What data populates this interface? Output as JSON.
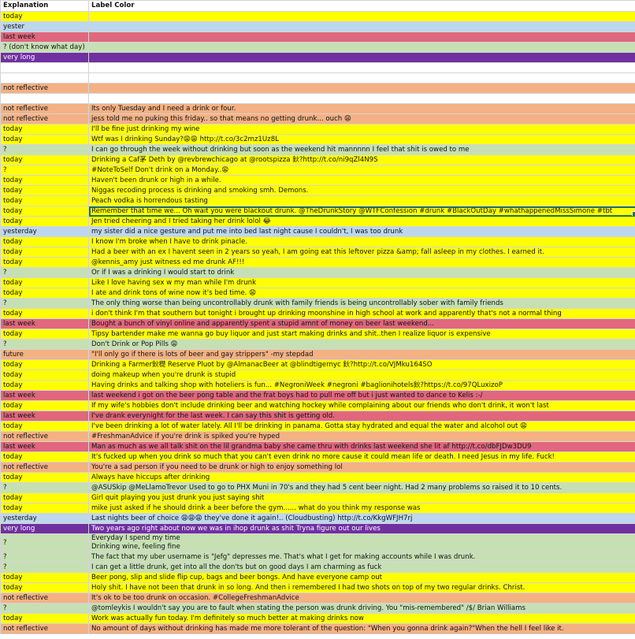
{
  "header": {
    "explanation": "Explanation",
    "label_color": "Label Color"
  },
  "colors": {
    "today": "#ffff00",
    "yesterday": "#bdd7ee",
    "last_week": "#e0677d",
    "unknown": "#c6e0b4",
    "very_long": "#7030a0",
    "not_reflective": "#f4b183",
    "selection": "#217346"
  },
  "rows": [
    {
      "explanation": "today",
      "text": "",
      "color": "yellow"
    },
    {
      "explanation": "yester",
      "text": "",
      "color": "blue"
    },
    {
      "explanation": "last week",
      "text": "",
      "color": "red"
    },
    {
      "explanation": "? (don't know what day)",
      "text": "",
      "color": "green"
    },
    {
      "explanation": "very long",
      "text": "",
      "color": "purple"
    },
    {
      "explanation": "",
      "text": "",
      "color": "white"
    },
    {
      "explanation": "",
      "text": "",
      "color": "white"
    },
    {
      "explanation": "not reflective",
      "text": "",
      "color": "orange"
    },
    {
      "explanation": "",
      "text": "",
      "color": "white"
    },
    {
      "explanation": "not reflective",
      "text": "Its only Tuesday and I need a drink or four.",
      "color": "orange"
    },
    {
      "explanation": "not reflective",
      "text": "jess told me no puking this friday.. so that means no getting drunk... ouch 😩",
      "color": "orange"
    },
    {
      "explanation": "today",
      "text": "I'll be fine just drinking my wine",
      "color": "yellow"
    },
    {
      "explanation": "today",
      "text": "Wtf was I drinking Sunday?😩😩 http://t.co/3c2mz1Uz8L",
      "color": "yellow"
    },
    {
      "explanation": "?",
      "text": "I can go through the week without drinking but soon as the weekend hit mannnnn I feel that shit is owed to me",
      "color": "green"
    },
    {
      "explanation": "today",
      "text": "Drinking a Caf茅 Deth by @revbrewchicago at @rootspizza 鈥?http://t.co/ni9qZl4N9S",
      "color": "yellow"
    },
    {
      "explanation": "?",
      "text": "#NoteToSelf Don't drink on a Monday..😩",
      "color": "yellow"
    },
    {
      "explanation": "today",
      "text": "Haven't been drunk or high in a while.",
      "color": "yellow"
    },
    {
      "explanation": "today",
      "text": "Niggas recoding process is drinking and smoking smh. Demons.",
      "color": "yellow"
    },
    {
      "explanation": "today",
      "text": "Peach vodka is horrendous tasting",
      "color": "yellow"
    },
    {
      "explanation": "today",
      "text": "Remember that time we... Oh wait you were blackout drunk. @TheDrunkStory @WTFConfession #drunk #BlackOutDay #whathappenedMissSimone #tbt",
      "color": "yellow",
      "selected": true
    },
    {
      "explanation": "today",
      "text": "Jen tried cheering and I tried taking her drink lolol 😂",
      "color": "yellow"
    },
    {
      "explanation": "yesterday",
      "text": "my sister did a nice gesture and put me into bed last night cause I couldn't, I was too drunk",
      "color": "blue"
    },
    {
      "explanation": "today",
      "text": "I know I'm broke when I have to drink pinacle.",
      "color": "yellow"
    },
    {
      "explanation": "today",
      "text": "Had a beer with an ex I havent seen in 2 years so yeah, I am going eat this leftover pizza &amp; fall asleep in my clothes. I earned it.",
      "color": "yellow"
    },
    {
      "explanation": "today",
      "text": "@kennis_amy just witness ed me drunk AF!!!",
      "color": "yellow"
    },
    {
      "explanation": "?",
      "text": "Or if I was a drinking I would start to drink",
      "color": "green"
    },
    {
      "explanation": "today",
      "text": "Like I love having sex w my man while I'm drunk",
      "color": "yellow"
    },
    {
      "explanation": "today",
      "text": "I ate and drink tons of wine now it's bed time. 😩",
      "color": "yellow"
    },
    {
      "explanation": "?",
      "text": "The only thing worse than being uncontrollably drunk with family friends is being uncontrollably sober with family friends",
      "color": "green"
    },
    {
      "explanation": "today",
      "text": "i don't think I'm that southern but tonight i brought up drinking moonshine in high school at work and apparently that's not a normal thing",
      "color": "yellow"
    },
    {
      "explanation": "last week",
      "text": "Bought a bunch of vinyl online and apparently spent a stupid amnt of money on beer last weekend...",
      "color": "red"
    },
    {
      "explanation": "today",
      "text": "Tipsy bartender make me wanna go buy liquor and just start making drinks and shit..then I realize liquor is expensive",
      "color": "yellow"
    },
    {
      "explanation": "?",
      "text": "Don't Drink or Pop Pills 😩",
      "color": "green"
    },
    {
      "explanation": "future",
      "text": "\"I'll only go if there is lots of beer and gay strippers\" -my stepdad",
      "color": "orange"
    },
    {
      "explanation": "today",
      "text": "Drinking a Farmer鈥檚 Reserve Pluot by @AlmanacBeer at @blindtigernyc 鈥?http://t.co/VJMku164SO",
      "color": "yellow"
    },
    {
      "explanation": "today",
      "text": "doing makeup when you're drunk is stupid",
      "color": "yellow"
    },
    {
      "explanation": "today",
      "text": "Having drinks and talking shop with hoteliers is fun... #NegroniWeek #negroni #baglionihotels鈥?https://t.co/97QLuxizoP",
      "color": "yellow"
    },
    {
      "explanation": "last week",
      "text": "last weekend i got on the beer pong table and the frat boys had to pull me off but i just wanted to dance to Kelis :-/",
      "color": "red"
    },
    {
      "explanation": "today",
      "text": "If my wife's hobbies don't include drinking beer and watching hockey while complaining about our friends who don't drink, it won't last",
      "color": "yellow"
    },
    {
      "explanation": "last week",
      "text": "I've drank everynight for the last week. I can say this shit is getting old.",
      "color": "red"
    },
    {
      "explanation": "today",
      "text": "I've been drinking a lot of water lately. All I'll be drinking in panama. Gotta stay hydrated and equal the water and alcohol out 😩",
      "color": "yellow"
    },
    {
      "explanation": "not reflective",
      "text": "#FreshmanAdvice if you're drink is spiked you're hyped",
      "color": "orange"
    },
    {
      "explanation": "last week",
      "text": "Man as much as we all talk shit on the lil grandma baby she came thru with drinks last weekend she lit af http://t.co/dbFJDw3DU9",
      "color": "red"
    },
    {
      "explanation": "today",
      "text": "It's fucked up when you drink so much that you can't even drink no more cause it could mean life or death. I need Jesus in my life. Fuck!",
      "color": "yellow"
    },
    {
      "explanation": "not reflective",
      "text": "You're a sad person if you need to be drunk or high to enjoy something lol",
      "color": "orange"
    },
    {
      "explanation": "today",
      "text": "Always have hiccups after drinking",
      "color": "yellow"
    },
    {
      "explanation": "?",
      "text": "@ASUSkip @MeLlamoTrevor Used to go to PHX Muni in 70's and they had 5 cent beer night. Had 2 many problems so raised it to 10 cents.",
      "color": "green"
    },
    {
      "explanation": "today",
      "text": "Girl quit playing you just drunk you just saying shit",
      "color": "yellow"
    },
    {
      "explanation": "today",
      "text": "mike just asked if he should drink a beer before the gym...... what do you think my response was",
      "color": "yellow"
    },
    {
      "explanation": "yesterday",
      "text": "Last nights beer of choice 😩😩😩 they've done it again!.. (Cloudbusting) http://t.co/KkgWFJH7rj",
      "color": "blue"
    },
    {
      "explanation": "very long",
      "text": "Two years ago right about now we was in ihop drunk as shit Tryna figure out our lives",
      "color": "purple"
    },
    {
      "explanation": "?",
      "text": "Everyday I spend my time\nDrinking wine, feeling fine",
      "color": "green",
      "wrap": true
    },
    {
      "explanation": "?",
      "text": "The fact that my uber username is \"Jefg\" depresses me. That's what I get for making accounts while I was drunk.",
      "color": "green"
    },
    {
      "explanation": "?",
      "text": "I can get a little drunk, get into all the don'ts but on good days I am charming as fuck",
      "color": "green"
    },
    {
      "explanation": "today",
      "text": "Beer pong, slip and slide flip cup, bags and beer bongs. And have everyone camp out",
      "color": "yellow"
    },
    {
      "explanation": "today",
      "text": "Holy shit. I have not been that drunk in so long. And then i remembered I had two shots on top of my two regular drinks. Christ.",
      "color": "yellow"
    },
    {
      "explanation": "not reflective",
      "text": "It's ok to be too drunk on occasion. #CollegeFreshmanAdvice",
      "color": "orange"
    },
    {
      "explanation": "?",
      "text": "@tomleykis I wouldn't say you are to fault when stating the person was drunk driving.  You \"mis-remembered\" /$/ Brian Williams",
      "color": "green"
    },
    {
      "explanation": "today",
      "text": "Work was actually fun today. I'm definitely so much better at making drinks now",
      "color": "yellow"
    },
    {
      "explanation": "not reflective",
      "text": "No amount of days without drinking has made me more tolerant of the question: \"When you gonna drink again?\"When the hell I feel like it.",
      "color": "orange"
    }
  ]
}
